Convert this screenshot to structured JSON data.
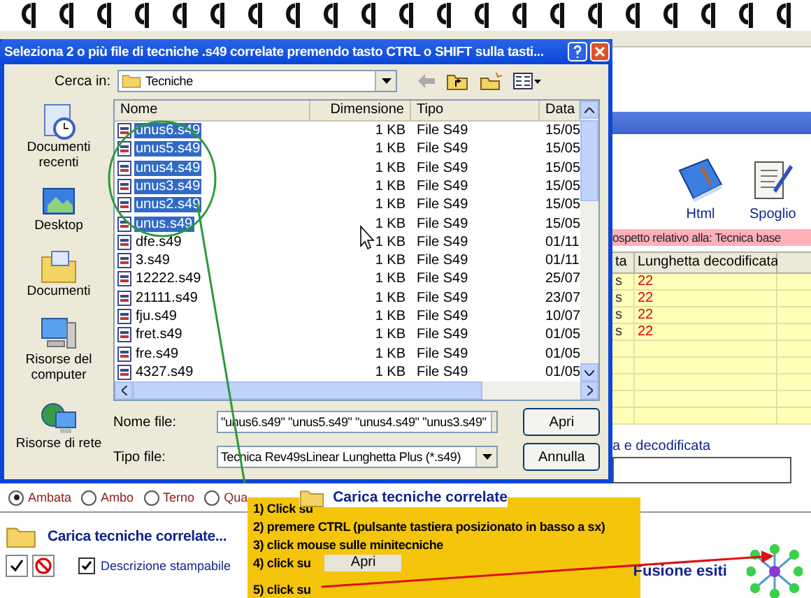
{
  "dialog": {
    "title": "Seleziona 2 o più file di tecniche .s49 correlate premendo tasto CTRL o SHIFT sulla tasti...",
    "look_in_label": "Cerca in:",
    "look_in_value": "Tecniche",
    "places": [
      {
        "label": "Documenti recenti",
        "kind": "recent"
      },
      {
        "label": "Desktop",
        "kind": "desktop"
      },
      {
        "label": "Documenti",
        "kind": "documents"
      },
      {
        "label": "Risorse del computer",
        "kind": "computer"
      },
      {
        "label": "Risorse di rete",
        "kind": "network"
      }
    ],
    "columns": [
      "Nome",
      "Dimensione",
      "Tipo",
      "Data"
    ],
    "files": [
      {
        "name": "unus6.s49",
        "size": "1 KB",
        "type": "File S49",
        "date": "15/05",
        "selected": true
      },
      {
        "name": "unus5.s49",
        "size": "1 KB",
        "type": "File S49",
        "date": "15/05",
        "selected": true
      },
      {
        "name": "unus4.s49",
        "size": "1 KB",
        "type": "File S49",
        "date": "15/05",
        "selected": true
      },
      {
        "name": "unus3.s49",
        "size": "1 KB",
        "type": "File S49",
        "date": "15/05",
        "selected": true
      },
      {
        "name": "unus2.s49",
        "size": "1 KB",
        "type": "File S49",
        "date": "15/05",
        "selected": true
      },
      {
        "name": "unus.s49",
        "size": "1 KB",
        "type": "File S49",
        "date": "15/05",
        "selected": true
      },
      {
        "name": "dfe.s49",
        "size": "1 KB",
        "type": "File S49",
        "date": "01/11",
        "selected": false
      },
      {
        "name": "3.s49",
        "size": "1 KB",
        "type": "File S49",
        "date": "01/11",
        "selected": false
      },
      {
        "name": "12222.s49",
        "size": "1 KB",
        "type": "File S49",
        "date": "25/07",
        "selected": false
      },
      {
        "name": "21111.s49",
        "size": "1 KB",
        "type": "File S49",
        "date": "23/07",
        "selected": false
      },
      {
        "name": "fju.s49",
        "size": "1 KB",
        "type": "File S49",
        "date": "10/07",
        "selected": false
      },
      {
        "name": "fret.s49",
        "size": "1 KB",
        "type": "File S49",
        "date": "01/05",
        "selected": false
      },
      {
        "name": "fre.s49",
        "size": "1 KB",
        "type": "File S49",
        "date": "01/05",
        "selected": false
      },
      {
        "name": "4327.s49",
        "size": "1 KB",
        "type": "File S49",
        "date": "01/05",
        "selected": false
      }
    ],
    "file_name_label": "Nome file:",
    "file_name_value": "\"unus6.s49\" \"unus5.s49\" \"unus4.s49\" \"unus3.s49\"",
    "file_type_label": "Tipo file:",
    "file_type_value": "Tecnica Rev49sLinear Lunghetta Plus (*.s49)",
    "buttons": [
      "Apri",
      "Annulla"
    ]
  },
  "toolbar": [
    {
      "label": "Html",
      "kind": "book"
    },
    {
      "label": "Spoglio",
      "kind": "scroll"
    }
  ],
  "report_banner": "ospetto relativo alla: Tecnica base",
  "table": {
    "columns": [
      "ta",
      "Lunghetta decodificata"
    ],
    "rows": [
      {
        "cells": [
          "s",
          "22"
        ]
      },
      {
        "cells": [
          "s",
          "22"
        ]
      },
      {
        "cells": [
          "s",
          "22"
        ]
      },
      {
        "cells": [
          "s",
          "22"
        ]
      }
    ]
  },
  "section_label": "a e decodificata",
  "game_options": [
    {
      "label": "Ambata",
      "selected": true
    },
    {
      "label": "Ambo",
      "selected": false
    },
    {
      "label": "Terno",
      "selected": false
    },
    {
      "label": "Qua",
      "selected": false
    }
  ],
  "load_link": "Carica tecniche correlate",
  "panel": {
    "title": "Carica tecniche correlate...",
    "print_description": {
      "label": "Descrizione stampabile",
      "checked": true
    },
    "fusion_label": "Fusione esiti"
  },
  "note": {
    "steps": [
      {
        "text": "1) Click su"
      },
      {
        "text": "2) premere CTRL (pulsante tastiera posizionato in basso a sx)"
      },
      {
        "text": "3) click mouse sulle minitecniche"
      },
      {
        "text": "4) click su",
        "button": "Apri"
      },
      {
        "text": "5) click su"
      }
    ]
  }
}
